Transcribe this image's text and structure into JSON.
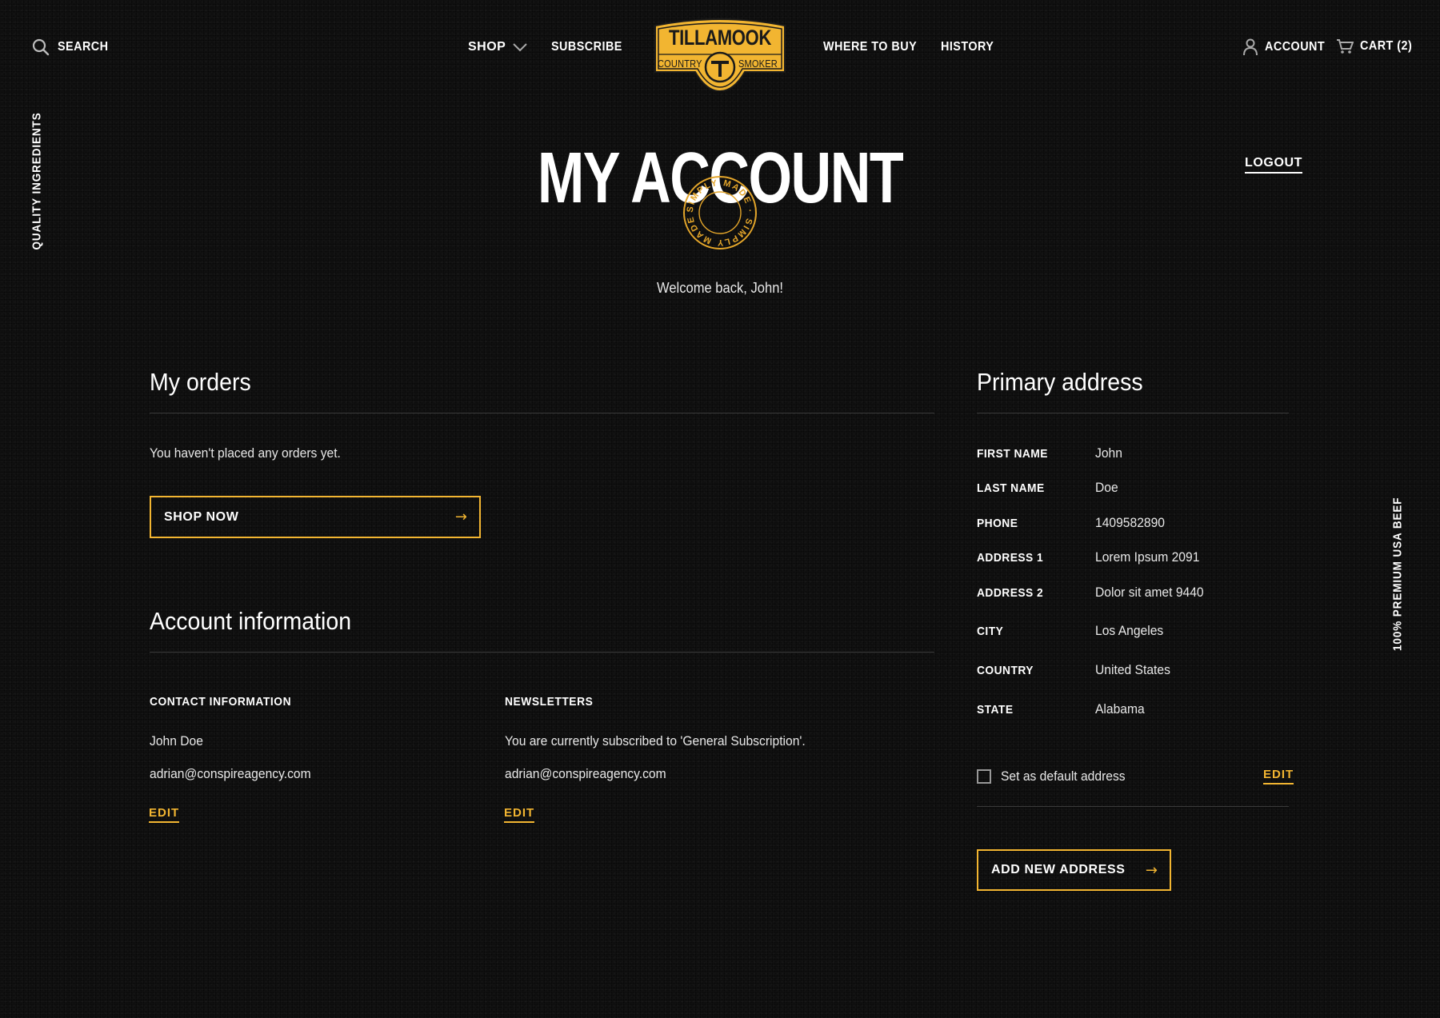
{
  "header": {
    "search_label": "SEARCH",
    "nav": {
      "shop": "SHOP",
      "subscribe": "SUBSCRIBE",
      "where_to_buy": "WHERE TO BUY",
      "history": "HISTORY"
    },
    "logo": {
      "top": "TILLAMOOK",
      "left": "COUNTRY",
      "right": "SMOKER"
    },
    "account_label": "ACCOUNT",
    "cart_label": "CART (2)"
  },
  "side": {
    "left_vertical": "QUALITY INGREDIENTS",
    "right_vertical": "100% PREMIUM USA BEEF"
  },
  "page": {
    "title": "MY ACCOUNT",
    "stamp_text": "SIMPLY MADE · SIMPLY MADE ·",
    "logout": "LOGOUT",
    "welcome": "Welcome back, John!"
  },
  "orders": {
    "title": "My orders",
    "empty_text": "You haven't placed any orders yet.",
    "shop_now": "SHOP NOW"
  },
  "account_info": {
    "title": "Account information",
    "contact": {
      "heading": "CONTACT INFORMATION",
      "name": "John Doe",
      "email": "adrian@conspireagency.com",
      "edit": "EDIT"
    },
    "newsletters": {
      "heading": "NEWSLETTERS",
      "status": "You are currently subscribed to 'General Subscription'.",
      "email": "adrian@conspireagency.com",
      "edit": "EDIT"
    }
  },
  "address": {
    "title": "Primary address",
    "rows": [
      {
        "label": "FIRST NAME",
        "value": "John"
      },
      {
        "label": "LAST NAME",
        "value": "Doe"
      },
      {
        "label": "PHONE",
        "value": "1409582890"
      },
      {
        "label": "ADDRESS 1",
        "value": "Lorem Ipsum 2091"
      },
      {
        "label": "ADDRESS 2",
        "value": "Dolor sit amet 9440"
      },
      {
        "label": "CITY",
        "value": "Los Angeles"
      },
      {
        "label": "COUNTRY",
        "value": "United States"
      },
      {
        "label": "STATE",
        "value": "Alabama"
      }
    ],
    "default_checkbox": {
      "label": "Set as default address",
      "checked": false
    },
    "edit": "EDIT",
    "add_new": "ADD NEW ADDRESS"
  },
  "colors": {
    "accent": "#f2b531",
    "background": "#121212",
    "text": "#ffffff",
    "divider": "#3a3a3a"
  }
}
